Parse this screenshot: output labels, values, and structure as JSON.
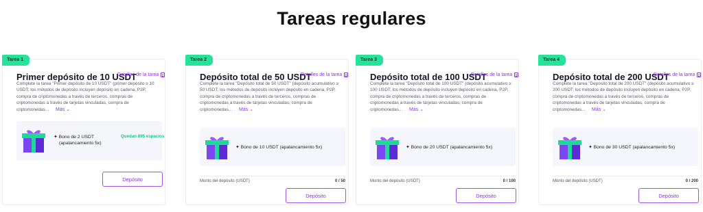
{
  "page": {
    "title": "Tareas regulares"
  },
  "common": {
    "details_label": "Detalles de la tarea",
    "more_label": "Más",
    "deposit_button": "Depósito",
    "progress_label": "Monto del depósito (USDT)"
  },
  "tasks": [
    {
      "badge": "Tarea 1",
      "title": "Primer depósito de 10 USDT",
      "description": "Complete la tarea \"Primer depósito de 10 USDT\" (primer depósito ≥ 10 USDT; los métodos de depósito incluyen depósito en cadena, P2P, compra de criptomonedas a través de terceros, compras de criptomonedas a través de tarjetas vinculadas, compra de criptomonedas...",
      "bonus_line1": "Bono de 2 USDT",
      "bonus_line2": "(apalancamiento 5x)",
      "spots": "Quedan 895 espacios"
    },
    {
      "badge": "Tarea 2",
      "title": "Depósito total de 50 USDT",
      "description": "Complete la tarea \"Depósito total de 50 USDT\" (depósito acumulativo ≥ 50 USDT; los métodos de depósito incluyen depósito en cadena, P2P, compra de criptomonedas a través de terceros, compras de criptomonedas a través de tarjetas vinculadas, compra de criptomonedas...",
      "bonus": "Bono de 10 USDT (apalancamiento 5x)",
      "progress": "0 / 50"
    },
    {
      "badge": "Tarea 3",
      "title": "Depósito total de 100 USDT",
      "description": "Complete la tarea \"Depósito total de 100 USDT\" (depósito acumulativo ≥ 100 USDT; los métodos de depósito incluyen depósito en cadena, P2P, compra de criptomonedas a través de terceros, compras de criptomonedas a través de tarjetas vinculadas, compra de criptomonedas...",
      "bonus": "Bono de 20 USDT (apalancamiento 5x)",
      "progress": "0 / 100"
    },
    {
      "badge": "Tarea 4",
      "title": "Depósito total de 200 USDT",
      "description": "Complete la tarea \"Depósito total de 200 USDT\" (depósito acumulativo ≥ 200 USDT; los métodos de depósito incluyen depósito en cadena, P2P, compra de criptomonedas a través de terceros, compras de criptomonedas a través de tarjetas vinculadas, compra de criptomonedas...",
      "bonus": "Bono de 30 USDT (apalancamiento 5x)",
      "progress": "0 / 200"
    }
  ],
  "icons": {
    "gift": "gift-icon",
    "details": "document-icon",
    "more": "chevron-down-icon",
    "plus": "plus-icon"
  },
  "colors": {
    "accent": "#8a37e0",
    "badge": "#25e39a",
    "spots": "#1ec683"
  }
}
